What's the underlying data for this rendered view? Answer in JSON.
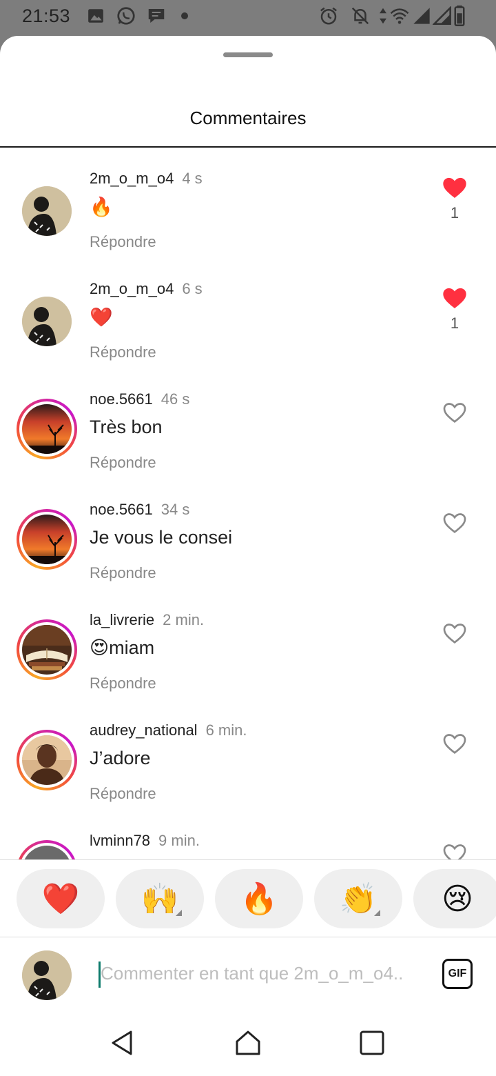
{
  "status": {
    "time": "21:53",
    "icons": [
      "image-icon",
      "whatsapp-icon",
      "chat-icon",
      "dot-icon",
      "alarm-icon",
      "mute-icon",
      "data-icon",
      "wifi-icon",
      "signal-icon",
      "signal-icon-2",
      "battery-icon"
    ]
  },
  "sheet": {
    "title": "Commentaires"
  },
  "comments": [
    {
      "user": "2m_o_m_o4",
      "time": "4 s",
      "text": "🔥",
      "reply": "Répondre",
      "liked": true,
      "likes": "1",
      "ring": false,
      "avatar": "own"
    },
    {
      "user": "2m_o_m_o4",
      "time": "6 s",
      "text": "❤️",
      "reply": "Répondre",
      "liked": true,
      "likes": "1",
      "ring": false,
      "avatar": "own"
    },
    {
      "user": "noe.5661",
      "time": "46 s",
      "text": "Très bon",
      "reply": "Répondre",
      "liked": false,
      "likes": "",
      "ring": true,
      "avatar": "sunset"
    },
    {
      "user": "noe.5661",
      "time": "34 s",
      "text": "Je vous le consei",
      "reply": "Répondre",
      "liked": false,
      "likes": "",
      "ring": true,
      "avatar": "sunset"
    },
    {
      "user": "la_livrerie",
      "time": "2 min.",
      "text": "😍miam",
      "reply": "Répondre",
      "liked": false,
      "likes": "",
      "ring": true,
      "avatar": "books"
    },
    {
      "user": "audrey_national",
      "time": "6 min.",
      "text": "J’adore",
      "reply": "Répondre",
      "liked": false,
      "likes": "",
      "ring": true,
      "avatar": "portrait"
    },
    {
      "user": "lvminn78",
      "time": "9 min.",
      "text": "",
      "reply": "",
      "liked": false,
      "likes": "",
      "ring": true,
      "avatar": "car"
    }
  ],
  "reactions": [
    {
      "emoji": "❤️",
      "name": "heart",
      "variants": false
    },
    {
      "emoji": "🙌",
      "name": "raised-hands",
      "variants": true
    },
    {
      "emoji": "🔥",
      "name": "fire",
      "variants": false
    },
    {
      "emoji": "👏",
      "name": "clapping-hands",
      "variants": true
    },
    {
      "emoji": "😢",
      "name": "crying-face",
      "variants": false
    }
  ],
  "composer": {
    "placeholder": "Commenter en tant que 2m_o_m_o4..",
    "gif_label": "GIF"
  },
  "colors": {
    "like": "#ff3040",
    "ring_start": "#f9a826",
    "ring_end": "#c916c9",
    "cursor": "#0b7a6b"
  }
}
